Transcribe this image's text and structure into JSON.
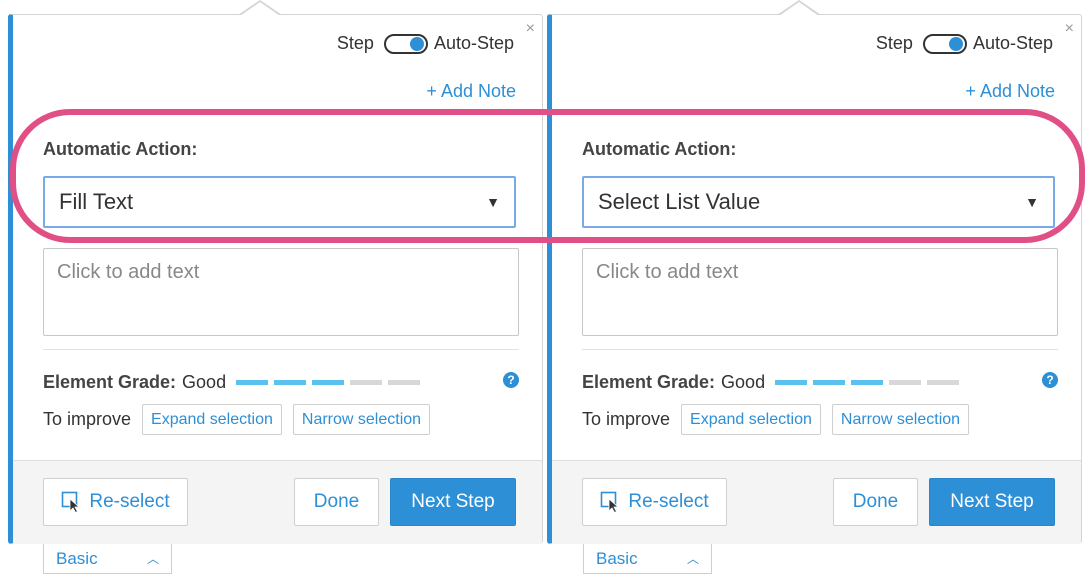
{
  "panels": [
    {
      "mode_left": "Step",
      "mode_right": "Auto-Step",
      "close": "×",
      "add_note": "+ Add Note",
      "action_label": "Automatic Action:",
      "action_value": "Fill Text",
      "text_placeholder": "Click to add text",
      "grade_label": "Element Grade:",
      "grade_value": "Good",
      "grade_level": 3,
      "grade_max": 5,
      "help": "?",
      "improve_label": "To improve",
      "expand": "Expand selection",
      "narrow": "Narrow selection",
      "reselect": "Re-select",
      "done": "Done",
      "next": "Next Step",
      "basic": "Basic"
    },
    {
      "mode_left": "Step",
      "mode_right": "Auto-Step",
      "close": "×",
      "add_note": "+ Add Note",
      "action_label": "Automatic Action:",
      "action_value": "Select List Value",
      "text_placeholder": "Click to add text",
      "grade_label": "Element Grade:",
      "grade_value": "Good",
      "grade_level": 3,
      "grade_max": 5,
      "help": "?",
      "improve_label": "To improve",
      "expand": "Expand selection",
      "narrow": "Narrow selection",
      "reselect": "Re-select",
      "done": "Done",
      "next": "Next Step",
      "basic": "Basic"
    }
  ],
  "colors": {
    "accent": "#2d8fd5",
    "highlight": "#e04f86",
    "grade_on": "#5bc2ef",
    "grade_off": "#d8d8d8"
  }
}
